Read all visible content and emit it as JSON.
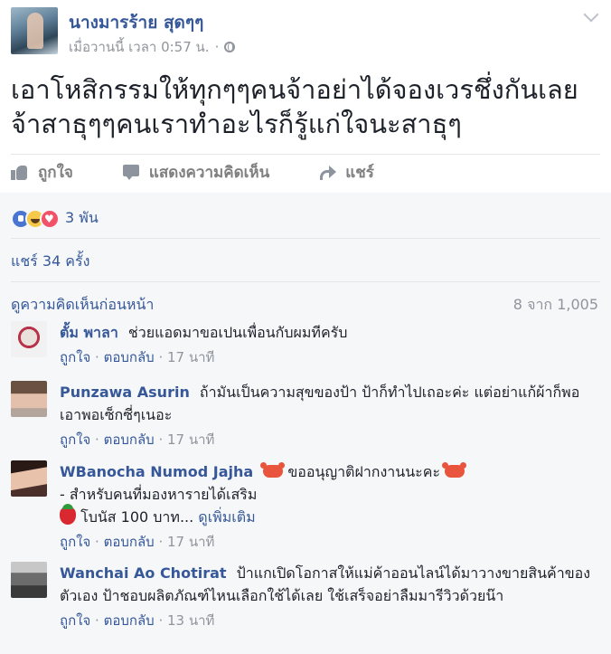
{
  "post": {
    "author": "นางมารร้าย สุดๆๆ",
    "timestamp": "เมื่อวานนี้ เวลา 0:57 น.",
    "separator": "·",
    "text": "เอาโหสิกรรมให้ทุกๆๆคนจ้าอย่าได้จองเวรชึ่งกันเลยจ้าสาธุๆๆคนเราทำอะไรก็รู้แก่ใจนะสาธุๆ",
    "actions": {
      "like": "ถูกใจ",
      "comment": "แสดงความคิดเห็น",
      "share": "แชร์"
    }
  },
  "summary": {
    "reaction_count": "3 พัน",
    "reactions": [
      "like",
      "haha",
      "love"
    ],
    "shares": "แชร์ 34 ครั้ง",
    "view_previous": "ดูความคิดเห็นก่อนหน้า",
    "comment_counter": "8 จาก 1,005"
  },
  "comments": [
    {
      "name": "ตั้ม พาลา",
      "text": "ช่วยแอดมาขอเปนเพื่อนกับผมทีครับ",
      "like": "ถูกใจ",
      "reply": "ตอบกลับ",
      "time": "17 นาที"
    },
    {
      "name": "Punzawa Asurin",
      "text": "ถ้ามันเป็นความสุขของป้า ป้าก็ทำไปเถอะค่ะ แต่อย่าแก้ผ้าก็พอเอาพอเซ็กซี่ๆเนอะ",
      "like": "ถูกใจ",
      "reply": "ตอบกลับ",
      "time": "17 นาที"
    },
    {
      "name": "WBanocha Numod Jajha",
      "text_line1": "ขออนุญาติฝากงานนะคะ",
      "text_line2": "- สำหรับคนที่มองหารายได้เสริม",
      "text_line3": "โบนัส 100 บาท...",
      "see_more": "ดูเพิ่มเติม",
      "like": "ถูกใจ",
      "reply": "ตอบกลับ",
      "time": "17 นาที",
      "emoji": [
        "crab",
        "strawberry"
      ]
    },
    {
      "name": "Wanchai Ao Chotirat",
      "text": "ป้าแกเปิดโอกาสให้แม่ค้าออนไลน์ได้มาวางขายสินค้าของตัวเอง ป้าชอบผลิตภัณฑ์ไหนเลือกใช้ได้เลย ใช้เสร็จอย่าลืมมารีวิวด้วยน๊า",
      "like": "ถูกใจ",
      "reply": "ตอบกลับ",
      "time": "13 นาที"
    }
  ],
  "colors": {
    "link": "#365899",
    "muted": "#90949c",
    "panel": "#f6f7f9"
  }
}
